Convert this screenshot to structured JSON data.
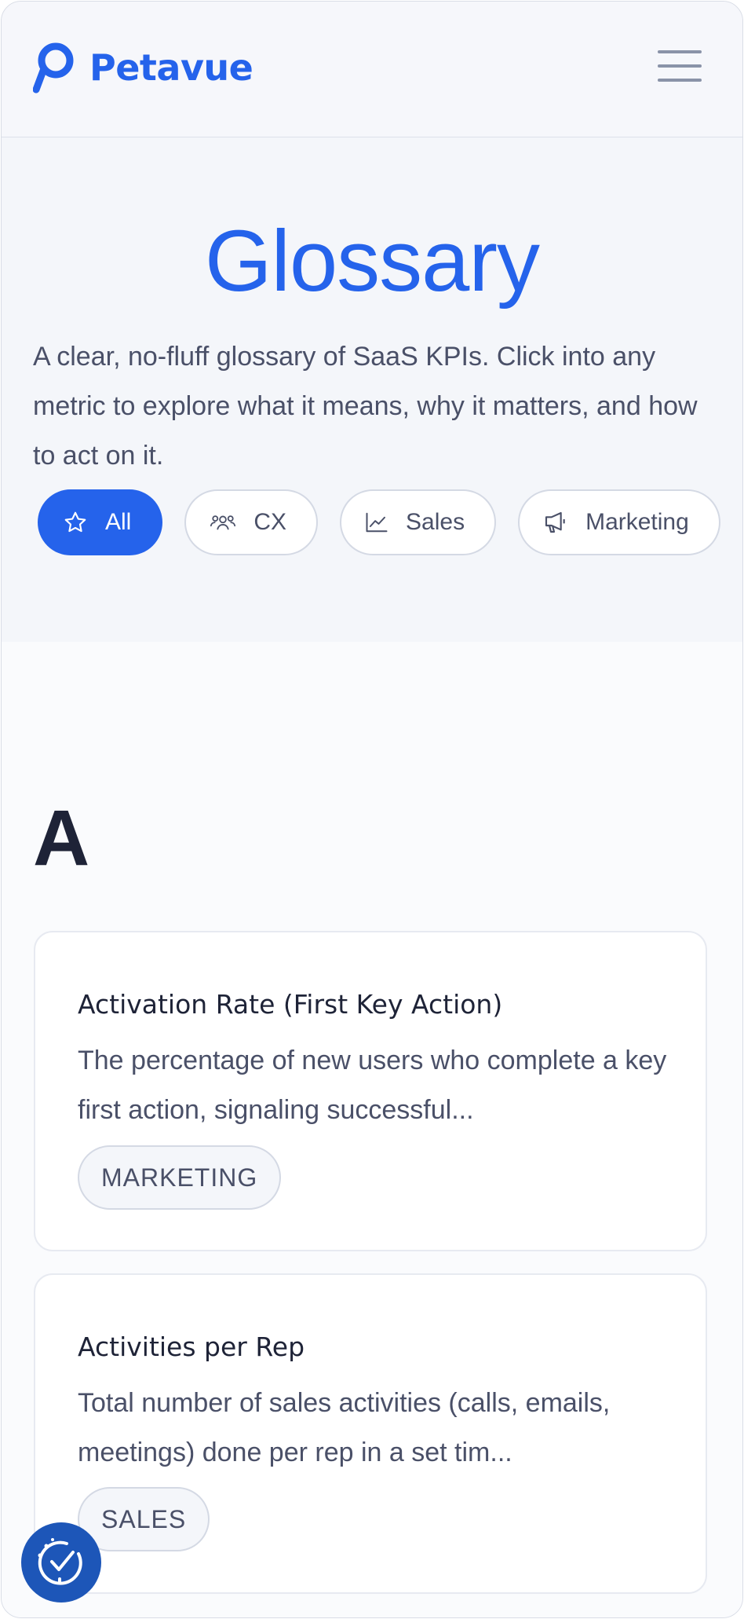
{
  "brand": {
    "name": "Petavue"
  },
  "hero": {
    "title": "Glossary",
    "intro": "A clear, no-fluff glossary of SaaS KPIs. Click into any metric to explore what it means, why it matters, and how to act on it."
  },
  "filters": [
    {
      "label": "All",
      "icon": "star-icon",
      "active": true
    },
    {
      "label": "CX",
      "icon": "users-icon",
      "active": false
    },
    {
      "label": "Sales",
      "icon": "trend-chart-icon",
      "active": false
    },
    {
      "label": "Marketing",
      "icon": "megaphone-icon",
      "active": false
    }
  ],
  "section": {
    "letter": "A"
  },
  "cards": [
    {
      "title": "Activation Rate (First Key Action)",
      "description": "The percentage of new users who complete a key first action, signaling successful...",
      "tag": "MARKETING"
    },
    {
      "title": "Activities per Rep",
      "description": "Total number of sales activities (calls, emails, meetings) done per rep in a set tim...",
      "tag": "SALES"
    }
  ],
  "colors": {
    "accent": "#2563eb",
    "text_dark": "#1e2337",
    "text_muted": "#4a5068",
    "badge": "#1d56b8"
  }
}
